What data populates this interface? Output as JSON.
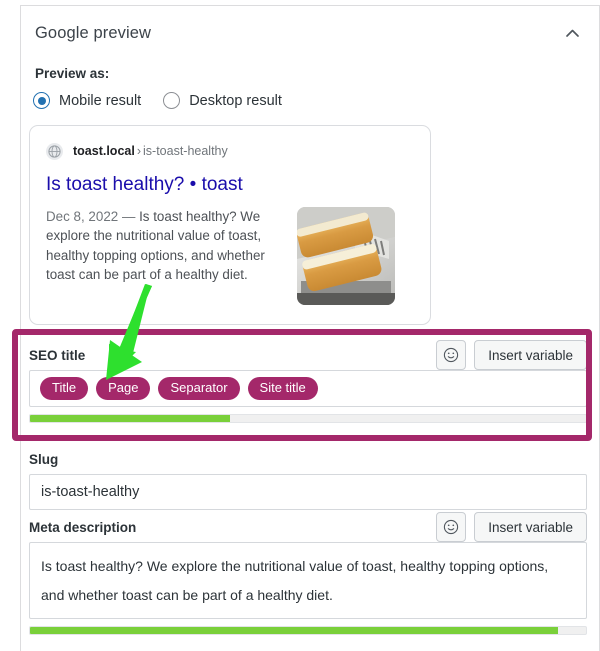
{
  "header": {
    "title": "Google preview",
    "collapse_icon": "chevron-up-icon"
  },
  "preview_as": {
    "label": "Preview as:",
    "options": [
      {
        "label": "Mobile result",
        "selected": true
      },
      {
        "label": "Desktop result",
        "selected": false
      }
    ]
  },
  "serp_preview": {
    "favicon_icon": "globe-icon",
    "domain": "toast.local",
    "breadcrumb_separator": "›",
    "slug_crumb": "is-toast-healthy",
    "title": "Is toast healthy? • toast",
    "date": "Dec 8, 2022",
    "date_separator": "—",
    "description": "Is toast healthy? We explore the nutritional value of toast, healthy topping options, and whether toast can be part of a healthy diet.",
    "thumbnail_alt": "Two slices of toast in a toaster"
  },
  "seo_title": {
    "label": "SEO title",
    "emoji_button_icon": "smiley-icon",
    "insert_variable_label": "Insert variable",
    "variables": [
      "Title",
      "Page",
      "Separator",
      "Site title"
    ],
    "progress_percent": 36,
    "progress_color": "#7ad03a",
    "highlight_color": "#a4286a"
  },
  "slug": {
    "label": "Slug",
    "value": "is-toast-healthy"
  },
  "meta_description": {
    "label": "Meta description",
    "emoji_button_icon": "smiley-icon",
    "insert_variable_label": "Insert variable",
    "value": "Is toast healthy? We explore the nutritional value of toast, healthy topping options, and whether toast can be part of a healthy diet.",
    "progress_percent": 95,
    "progress_color": "#7ad03a"
  },
  "annotation": {
    "arrow_color": "#2ee02e",
    "arrow_points_to": "Page variable pill"
  }
}
